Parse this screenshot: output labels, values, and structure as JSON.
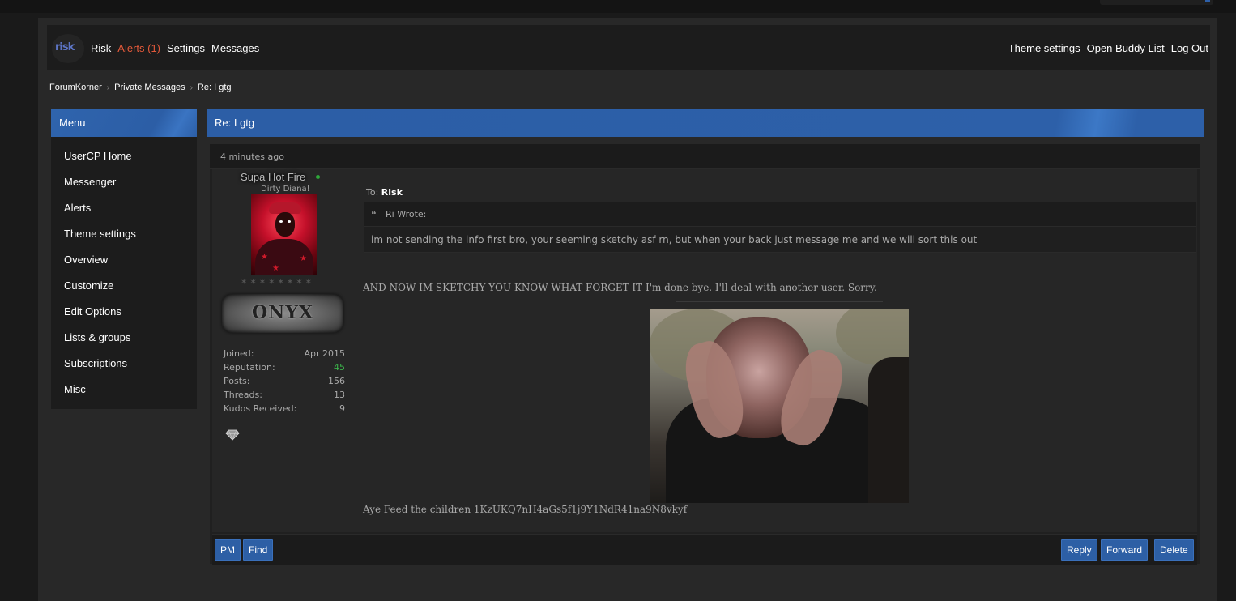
{
  "header": {
    "username_link": "Risk",
    "alerts": "Alerts (1)",
    "settings": "Settings",
    "messages": "Messages",
    "theme_settings": "Theme settings",
    "buddy_list": "Open Buddy List",
    "logout": "Log Out",
    "logo_text": "risk"
  },
  "breadcrumb": [
    "ForumKorner",
    "Private Messages",
    "Re: I gtg"
  ],
  "menu": {
    "title": "Menu",
    "items": [
      "UserCP Home",
      "Messenger",
      "Alerts",
      "Theme settings",
      "Overview",
      "Customize",
      "Edit Options",
      "Lists & groups",
      "Subscriptions",
      "Misc"
    ]
  },
  "message": {
    "subject": "Re: I gtg",
    "time": "4 minutes ago",
    "to_label": "To:",
    "to_user": "Risk",
    "quote_author": "Ri Wrote:",
    "quote_text": "im not sending the info first bro, your seeming sketchy asf rn, but when your back just message me and we will sort this out",
    "body": "AND NOW IM SKETCHY YOU KNOW WHAT FORGET IT I'm done bye. I'll deal with another user. Sorry.",
    "footer_text": "Aye Feed the children 1KzUKQ7nH4aGs5f1j9Y1NdR41na9N8vkyf"
  },
  "author": {
    "name": "Supa Hot Fire",
    "title": "Dirty Diana!",
    "rank": "ONYX",
    "stats": [
      {
        "label": "Joined:",
        "value": "Apr 2015"
      },
      {
        "label": "Reputation:",
        "value": "45"
      },
      {
        "label": "Posts:",
        "value": "156"
      },
      {
        "label": "Threads:",
        "value": "13"
      },
      {
        "label": "Kudos Received:",
        "value": "9"
      }
    ]
  },
  "buttons": {
    "pm": "PM",
    "find": "Find",
    "reply": "Reply",
    "forward": "Forward",
    "delete": "Delete"
  },
  "colors": {
    "accent_blue": "#2d5fa5",
    "alert_red": "#e2593a",
    "rep_green": "#3bb34a"
  }
}
